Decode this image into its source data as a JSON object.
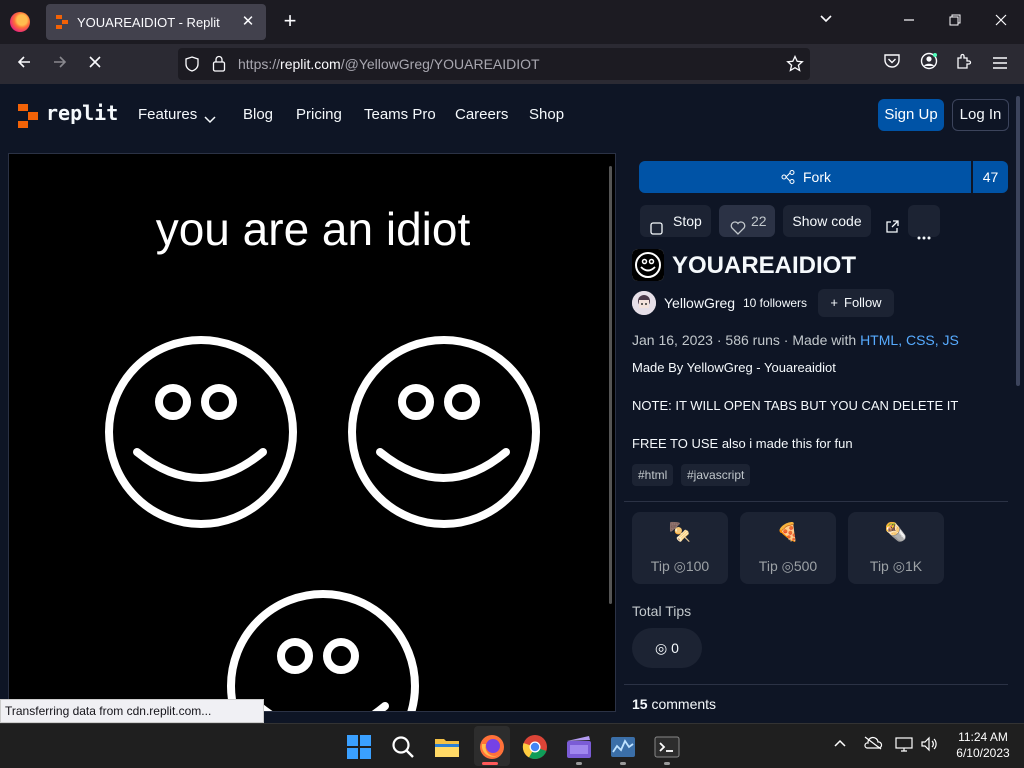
{
  "browser": {
    "tab_title": "YOUAREAIDIOT - Replit",
    "tab_close": "✕",
    "new_tab": "+",
    "url_prefix": "https://",
    "url_domain": "replit.com",
    "url_path": "/@YellowGreg/YOUAREAIDIOT",
    "status_text": "Transferring data from cdn.replit.com..."
  },
  "header": {
    "logo_text": "replit",
    "menu": [
      {
        "label": "Features"
      },
      {
        "label": "Blog"
      },
      {
        "label": "Pricing"
      },
      {
        "label": "Teams Pro"
      },
      {
        "label": "Careers"
      },
      {
        "label": "Shop"
      }
    ],
    "signup_label": "Sign Up",
    "login_label": "Log In"
  },
  "output": {
    "title": "you are an idiot"
  },
  "repl": {
    "fork_label": "Fork",
    "fork_count": "47",
    "stop_label": "Stop",
    "likes": "22",
    "show_code_label": "Show code",
    "title": "YOUAREAIDIOT",
    "author": "YellowGreg",
    "followers": "10 followers",
    "follow_label": "Follow",
    "meta_date": "Jan 16, 2023",
    "meta_runs": "586 runs",
    "meta_made_with": "Made with",
    "languages": [
      "HTML",
      "CSS",
      "JS"
    ],
    "description": [
      "Made By YellowGreg - Youareaidiot",
      "NOTE: IT WILL OPEN TABS BUT YOU CAN DELETE IT",
      "FREE TO USE also i made this for fun"
    ],
    "tags": [
      "#html",
      "#javascript"
    ],
    "tips": [
      {
        "emoji": "🍢",
        "label": "Tip",
        "amount": "100"
      },
      {
        "emoji": "🍕",
        "label": "Tip",
        "amount": "500"
      },
      {
        "emoji": "🌯",
        "label": "Tip",
        "amount": "1K"
      }
    ],
    "total_tips_label": "Total Tips",
    "total_tips": "0",
    "comments_count": "15",
    "comments_label": "comments"
  },
  "taskbar": {
    "time": "11:24 AM",
    "date": "6/10/2023"
  },
  "colors": {
    "accent": "#0053a6",
    "link": "#57abff",
    "replit_orange": "#f26207",
    "page_bg": "#0e1525"
  }
}
